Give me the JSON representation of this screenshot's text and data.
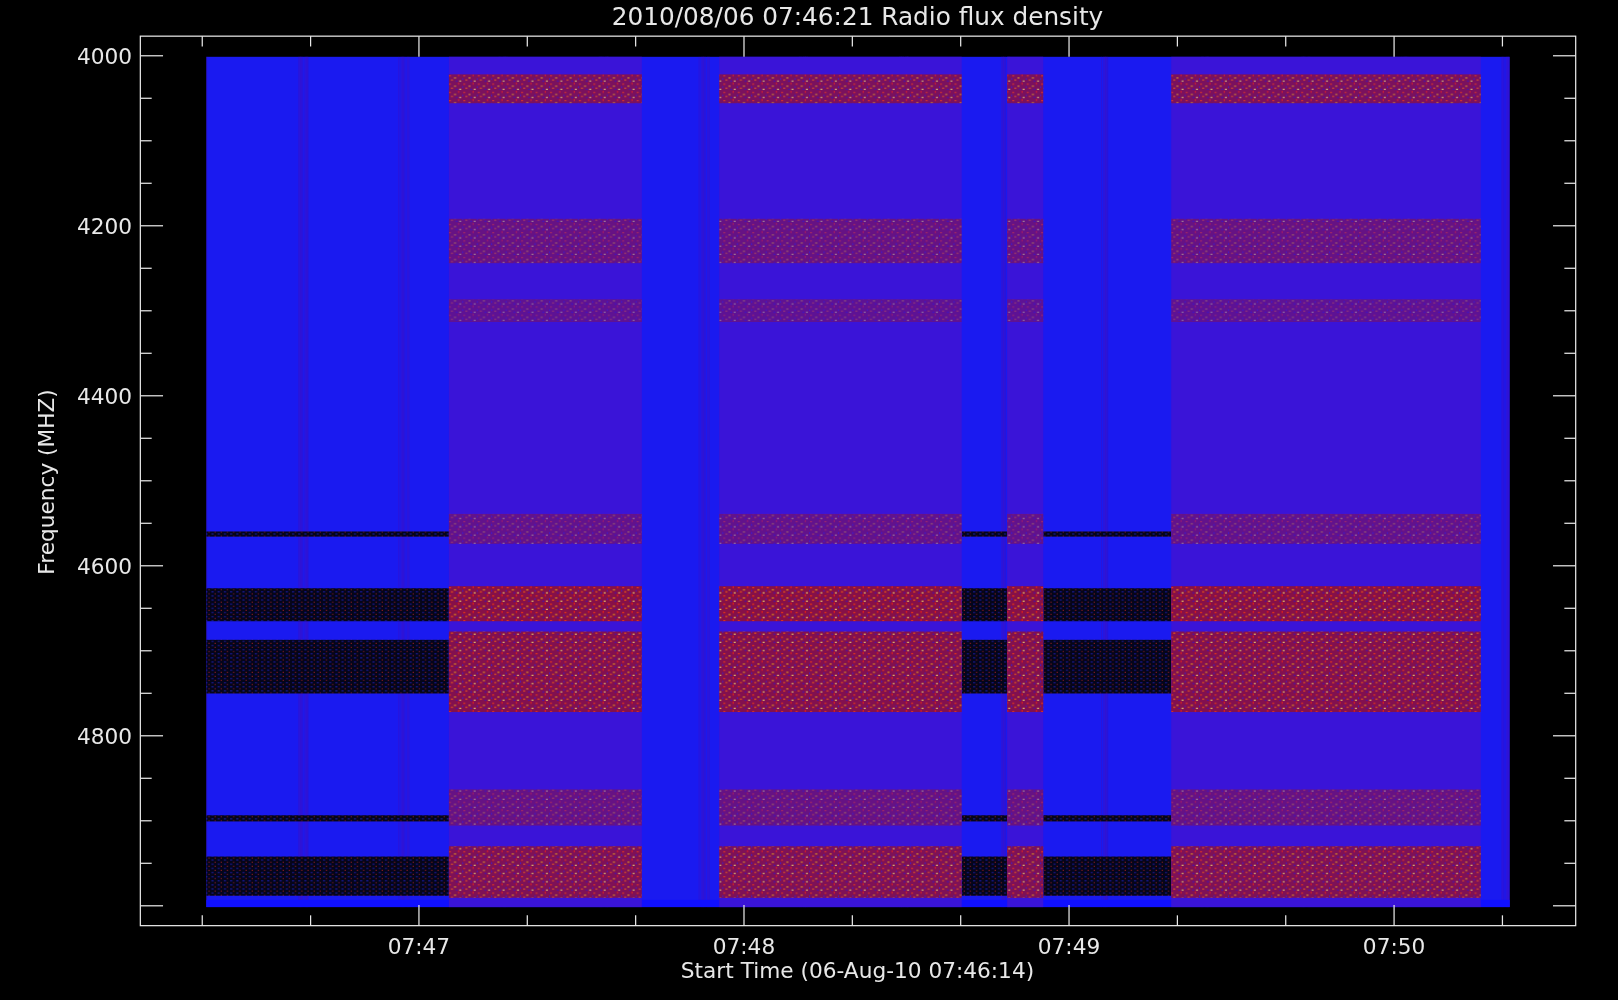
{
  "title": "2010/08/06 07:46:21 Radio flux density",
  "y_axis": {
    "label": "Frequency (MHZ)",
    "ticks": [
      "4000",
      "4200",
      "4400",
      "4600",
      "4800"
    ]
  },
  "x_axis": {
    "label": "Start Time (06-Aug-10 07:46:14)",
    "ticks": [
      "07:47",
      "07:48",
      "07:49",
      "07:50"
    ]
  }
}
